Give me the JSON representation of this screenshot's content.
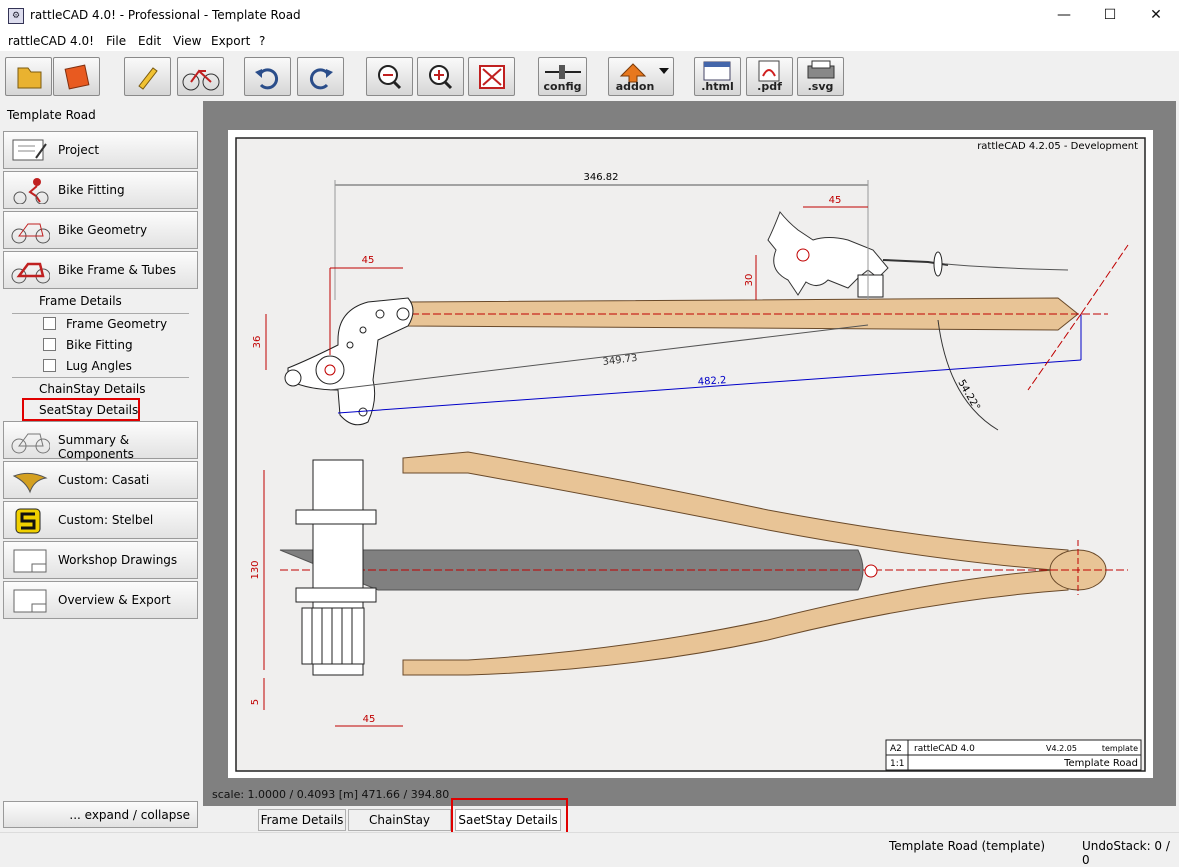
{
  "window": {
    "title": "rattleCAD 4.0! - Professional  - Template Road"
  },
  "menu": {
    "items": [
      "rattleCAD 4.0!",
      "File",
      "Edit",
      "View",
      "Export",
      "?"
    ]
  },
  "toolbar": {
    "config_label": "config",
    "addon_label": "addon",
    "html_label": ".html",
    "pdf_label": ".pdf",
    "svg_label": ".svg"
  },
  "sidebar": {
    "title": "Template Road",
    "nav": [
      {
        "label": "Project"
      },
      {
        "label": "Bike Fitting"
      },
      {
        "label": "Bike Geometry"
      },
      {
        "label": "Bike Frame & Tubes"
      }
    ],
    "frame_details_label": "Frame Details",
    "checks": [
      "Frame Geometry",
      "Bike Fitting",
      "Lug Angles"
    ],
    "chainstay_label": "ChainStay Details",
    "seatstay_label": "SeatStay Details",
    "nav2": [
      {
        "label": "Summary & Components"
      },
      {
        "label": "Custom: Casati"
      },
      {
        "label": "Custom: Stelbel"
      },
      {
        "label": "Workshop Drawings"
      },
      {
        "label": "Overview & Export"
      }
    ],
    "expand_label": "... expand / collapse"
  },
  "drawing": {
    "header": "rattleCAD  4.2.05  -  Development",
    "dims": {
      "d1": "346.82",
      "d2": "45",
      "d3": "45",
      "d4": "30",
      "d5": "36",
      "d6": "349.73",
      "d7": "482.2",
      "d8": "54.22°",
      "d9": "130",
      "d10": "5",
      "d11": "45"
    },
    "titleblock": {
      "size": "A2",
      "app": "rattleCAD 4.0",
      "version": "V4.2.05",
      "kind": "template",
      "scale": "1:1",
      "name": "Template Road"
    },
    "colors": {
      "tube": "#e8c496",
      "outline": "#6a4a2a",
      "dim_red": "#c00000",
      "dim_blue": "#0000c8"
    }
  },
  "scale_text": "scale: 1.0000 / 0.4093  [m]  471.66 / 394.80",
  "tabs": [
    "Frame Details",
    "ChainStay Details",
    "SaetStay Details"
  ],
  "status": {
    "project": "Template Road (template)",
    "undo": "UndoStack:  0 / 0"
  }
}
